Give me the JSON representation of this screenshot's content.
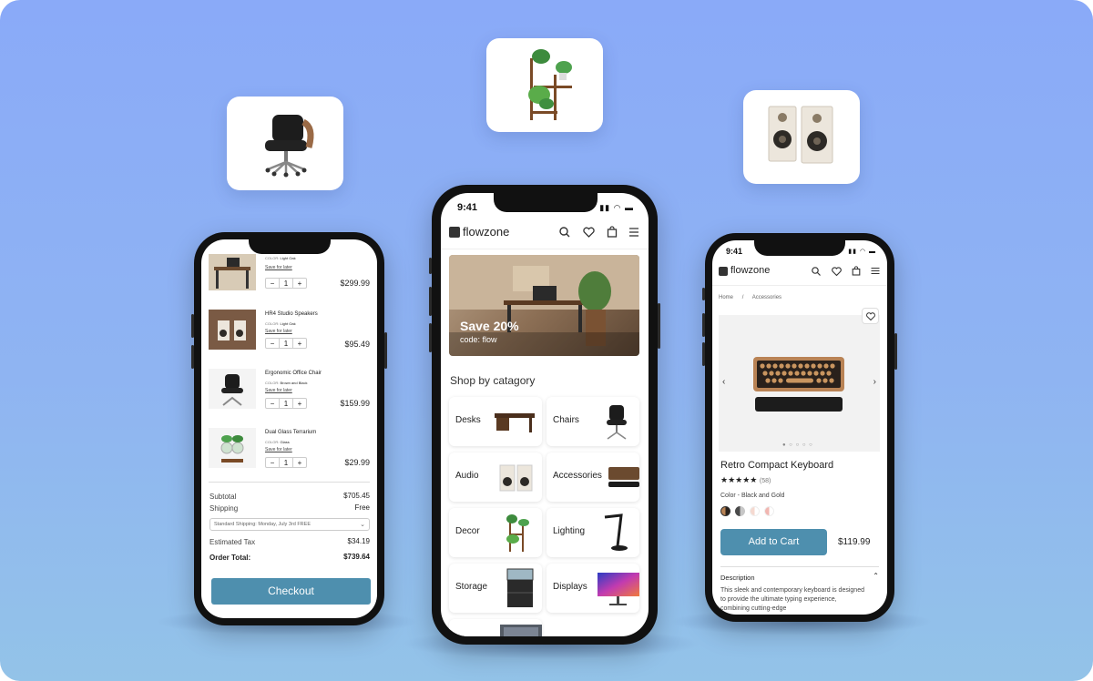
{
  "left_phone": {
    "cart_items": [
      {
        "name": "",
        "color_label": "COLOR:",
        "color_value": "Light Oak",
        "save": "Save for later",
        "qty": "1",
        "price": "$299.99"
      },
      {
        "name": "HR4 Studio Speakers",
        "color_label": "COLOR:",
        "color_value": "Light Oak",
        "save": "Save for later",
        "qty": "1",
        "price": "$95.49"
      },
      {
        "name": "Ergonomic Office Chair",
        "color_label": "COLOR:",
        "color_value": "Brown and Black",
        "save": "Save for later",
        "qty": "1",
        "price": "$159.99"
      },
      {
        "name": "Dual Glass Terrarium",
        "color_label": "COLOR:",
        "color_value": "Glass",
        "save": "Save for later",
        "qty": "1",
        "price": "$29.99"
      }
    ],
    "summary": {
      "subtotal_label": "Subtotal",
      "subtotal": "$705.45",
      "shipping_label": "Shipping",
      "shipping": "Free",
      "shipping_option": "Standard Shipping: Monday, July 3rd FREE",
      "tax_label": "Estimated Tax",
      "tax": "$34.19",
      "total_label": "Order Total:",
      "total": "$739.64"
    },
    "checkout_label": "Checkout"
  },
  "center_phone": {
    "time": "9:41",
    "brand": "flowzone",
    "hero": {
      "headline": "Save 20%",
      "code": "code: flow"
    },
    "section_title": "Shop by catagory",
    "categories": [
      "Desks",
      "Chairs",
      "Audio",
      "Accessories",
      "Decor",
      "Lighting",
      "Storage",
      "Displays"
    ]
  },
  "right_phone": {
    "time": "9:41",
    "brand": "flowzone",
    "breadcrumb": {
      "home": "Home",
      "sep": "/",
      "current": "Accessories"
    },
    "product_title": "Retro Compact Keyboard",
    "rating_stars": "★★★★★",
    "rating_count": "(58)",
    "color_text": "Color - Black and Gold",
    "add_to_cart": "Add to Cart",
    "price": "$119.99",
    "description_title": "Description",
    "description_text": "This sleek and contemporary keyboard is designed to provide the ultimate typing experience, combining cutting-edge"
  },
  "colors": {
    "accent": "#4e8fae",
    "background_top": "#8aaaf8",
    "background_bottom": "#93c3e8"
  }
}
